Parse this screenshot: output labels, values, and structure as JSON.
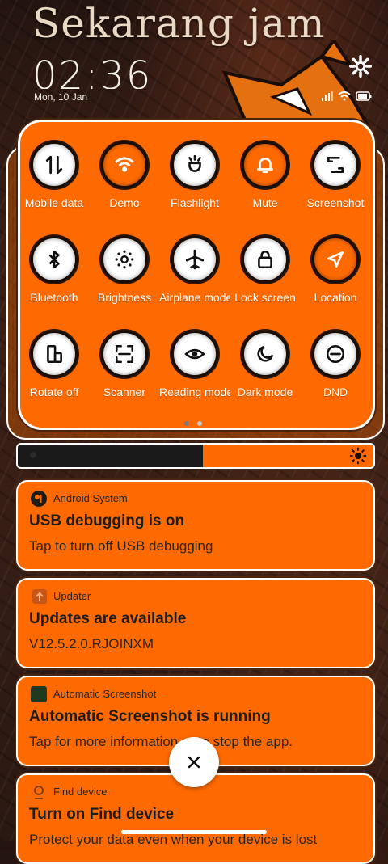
{
  "header": {
    "greeting": "Sekarang jam",
    "time": "02:36",
    "date": "Mon, 10 Jan"
  },
  "quick_settings": {
    "rows": [
      [
        {
          "label": "Mobile data",
          "icon": "mobile-data-icon",
          "active": false
        },
        {
          "label": "Demo",
          "icon": "wifi-icon",
          "active": true
        },
        {
          "label": "Flashlight",
          "icon": "flashlight-icon",
          "active": false
        },
        {
          "label": "Mute",
          "icon": "bell-icon",
          "active": true
        },
        {
          "label": "Screenshot",
          "icon": "screenshot-icon",
          "active": false
        }
      ],
      [
        {
          "label": "Bluetooth",
          "icon": "bluetooth-icon",
          "active": false
        },
        {
          "label": "Brightness",
          "icon": "brightness-icon",
          "active": false
        },
        {
          "label": "Airplane mode",
          "icon": "airplane-icon",
          "active": false
        },
        {
          "label": "Lock screen",
          "icon": "lock-icon",
          "active": false
        },
        {
          "label": "Location",
          "icon": "location-icon",
          "active": true
        }
      ],
      [
        {
          "label": "Rotate off",
          "icon": "rotate-icon",
          "active": false
        },
        {
          "label": "Scanner",
          "icon": "scanner-icon",
          "active": false
        },
        {
          "label": "Reading mode",
          "icon": "eye-icon",
          "active": false
        },
        {
          "label": "Dark mode",
          "icon": "moon-icon",
          "active": false
        },
        {
          "label": "DND",
          "icon": "dnd-icon",
          "active": false
        }
      ]
    ],
    "page_count": 2,
    "current_page": 1
  },
  "brightness": {
    "level": 0.52
  },
  "notifications": [
    {
      "app": "Android System",
      "title": "USB debugging is on",
      "body": "Tap to turn off USB debugging",
      "icon": "android-system-icon"
    },
    {
      "app": "Updater",
      "title": "Updates are available",
      "body": "V12.5.2.0.RJOINXM",
      "icon": "updater-icon"
    },
    {
      "app": "Automatic Screenshot",
      "title": "Automatic Screenshot is running",
      "body": "Tap for more information or to stop the app.",
      "icon": "auto-screenshot-icon"
    },
    {
      "app": "Find device",
      "title": "Turn on Find device",
      "body": "Protect your data even when your device is lost",
      "icon": "find-device-icon"
    }
  ],
  "colors": {
    "accent": "#ff6a00",
    "panel_border": "#ffffff",
    "text_dark": "#1f1c18"
  }
}
